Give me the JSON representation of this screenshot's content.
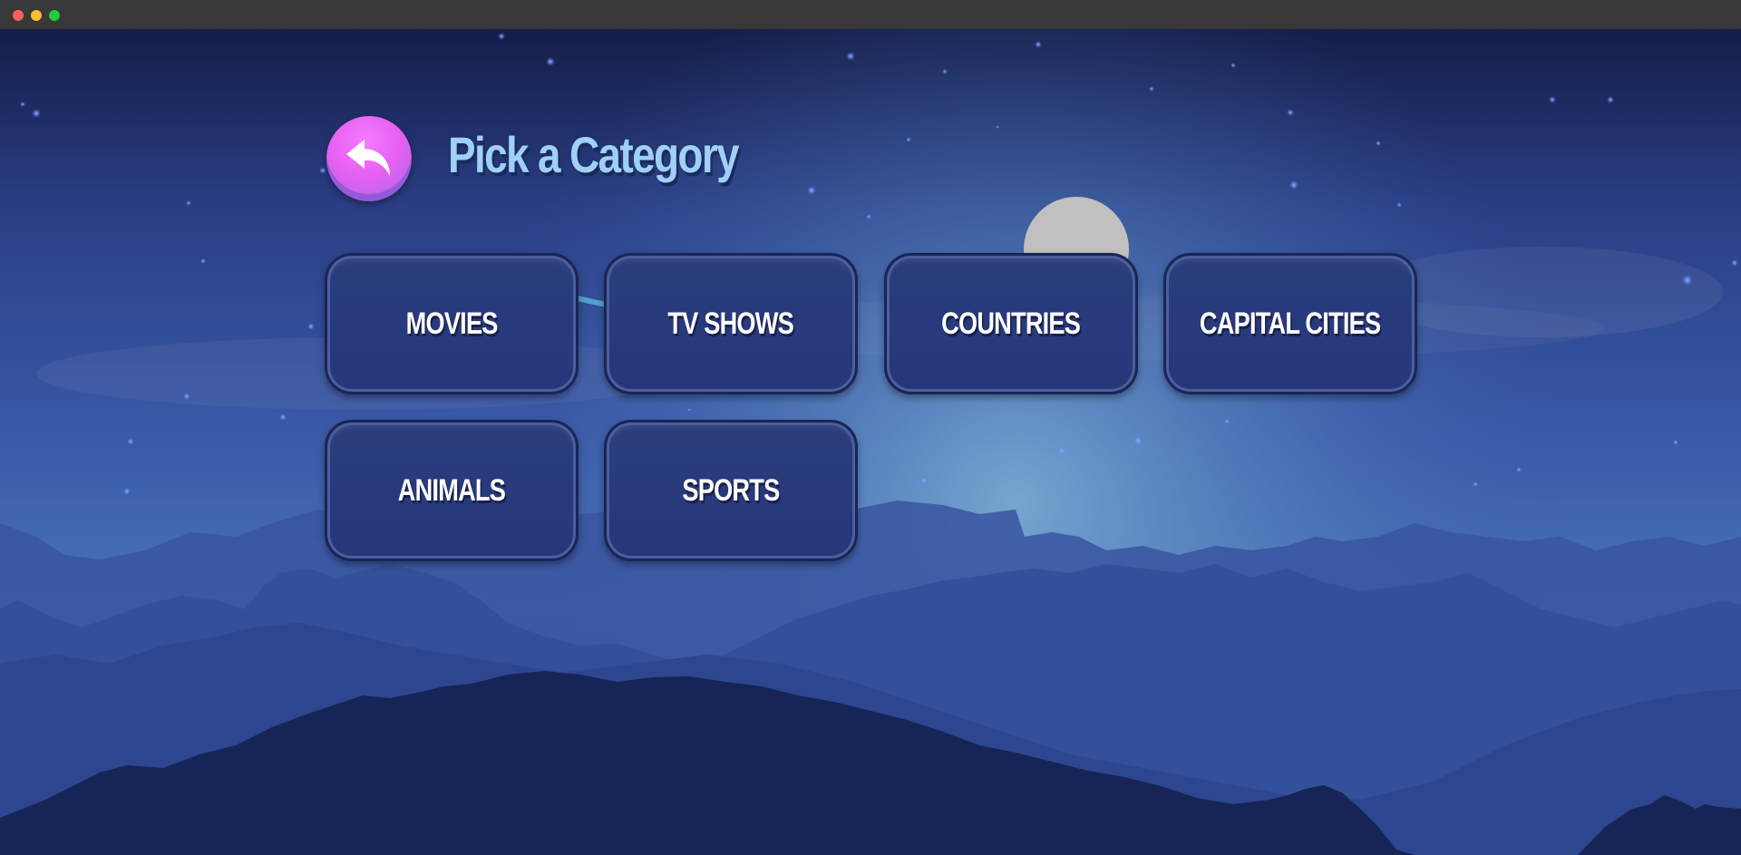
{
  "window": {
    "traffic_lights": [
      "close",
      "minimize",
      "maximize"
    ]
  },
  "header": {
    "title": "Pick a Category",
    "back_icon": "back-arrow-icon"
  },
  "categories": [
    "MOVIES",
    "TV SHOWS",
    "COUNTRIES",
    "CAPITAL CITIES",
    "ANIMALS",
    "SPORTS"
  ],
  "colors": {
    "sky_top": "#151d48",
    "sky_mid": "#3454a0",
    "glow": "#6fa2cf",
    "tile": "#283b7b",
    "title": "#9fd0f7",
    "back_button": "#e866f2",
    "moon": "#c0c0c0"
  }
}
